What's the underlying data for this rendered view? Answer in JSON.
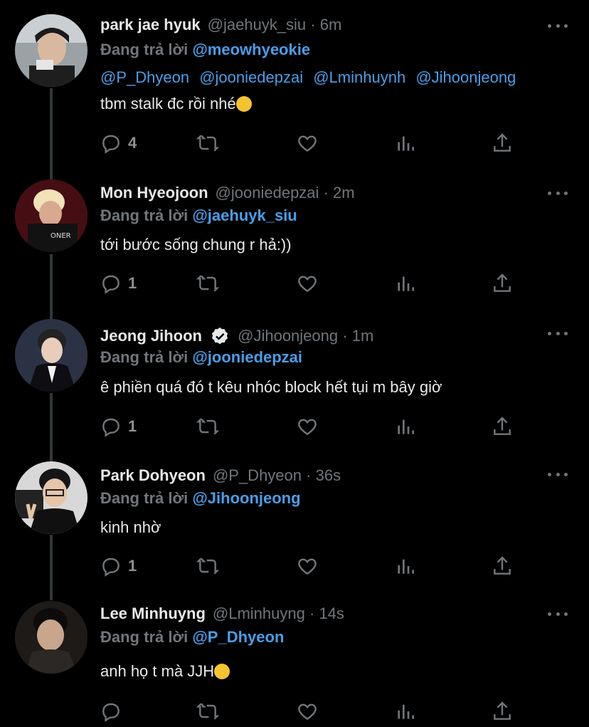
{
  "tweets": [
    {
      "name": "park jae hyuk",
      "handle": "@jaehuyk_siu",
      "time": "6m",
      "verified": false,
      "replying_prefix": "Đang trả lời",
      "replying_to": "@meowhyeokie",
      "mentions": [
        "@P_Dhyeon",
        "@jooniedepzai",
        "@Lminhuynh",
        "@Jihoonjeong"
      ],
      "text": "tbm stalk đc rồi nhé",
      "emoji": "shushing-face-emoji",
      "reply_count": "4"
    },
    {
      "name": "Mon Hyeojoon",
      "handle": "@jooniedepzai",
      "time": "2m",
      "verified": false,
      "replying_prefix": "Đang trả lời",
      "replying_to": "@jaehuyk_siu",
      "text": "tới bước sống chung r hả:))",
      "reply_count": "1"
    },
    {
      "name": "Jeong Jihoon",
      "handle": "@Jihoonjeong",
      "time": "1m",
      "verified": true,
      "replying_prefix": "Đang trả lời",
      "replying_to": "@jooniedepzai",
      "text": "ê phiền quá đó t kêu nhóc block hết tụi m bây giờ",
      "reply_count": "1"
    },
    {
      "name": "Park Dohyeon",
      "handle": "@P_Dhyeon",
      "time": "36s",
      "verified": false,
      "replying_prefix": "Đang trả lời",
      "replying_to": "@Jihoonjeong",
      "text": "kinh nhờ",
      "reply_count": "1"
    },
    {
      "name": "Lee Minhuyng",
      "handle": "@Lminhuyng",
      "time": "14s",
      "verified": false,
      "replying_prefix": "Đang trả lời",
      "replying_to": "@P_Dhyeon",
      "text": "anh họ t mà JJH",
      "emoji": "crying-face-emoji",
      "reply_count": ""
    }
  ],
  "separator": "·",
  "colors": {
    "background": "#000000",
    "text": "#e7e9ea",
    "muted": "#71767b",
    "mention": "#4a9ee8",
    "thread_line": "#333639"
  },
  "icons": [
    "reply-icon",
    "retweet-icon",
    "like-icon",
    "analytics-icon",
    "share-icon",
    "more-icon",
    "verified-icon"
  ]
}
